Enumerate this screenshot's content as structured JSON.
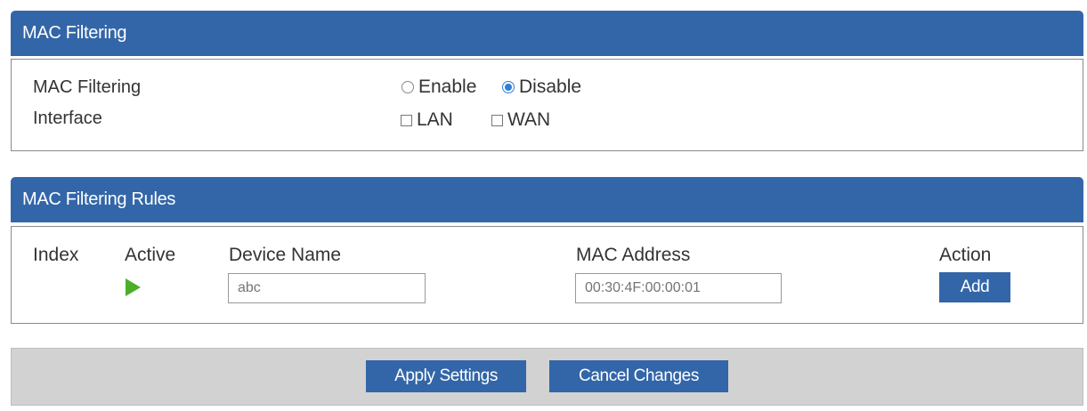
{
  "mac_filtering_panel": {
    "title": "MAC Filtering",
    "mac_filtering_label": "MAC Filtering",
    "enable_label": "Enable",
    "disable_label": "Disable",
    "selected": "Disable",
    "interface_label": "Interface",
    "lan_label": "LAN",
    "wan_label": "WAN",
    "lan_checked": false,
    "wan_checked": false
  },
  "rules_panel": {
    "title": "MAC Filtering Rules",
    "columns": {
      "index": "Index",
      "active": "Active",
      "device_name": "Device Name",
      "mac_address": "MAC Address",
      "action": "Action"
    },
    "device_name_placeholder": "abc",
    "mac_address_placeholder": "00:30:4F:00:00:01",
    "add_label": "Add"
  },
  "footer": {
    "apply_label": "Apply Settings",
    "cancel_label": "Cancel Changes"
  },
  "colors": {
    "header": "#3366a8",
    "button": "#3366a8",
    "active_icon": "#4caf2a",
    "footer_bar": "#d2d2d2"
  }
}
